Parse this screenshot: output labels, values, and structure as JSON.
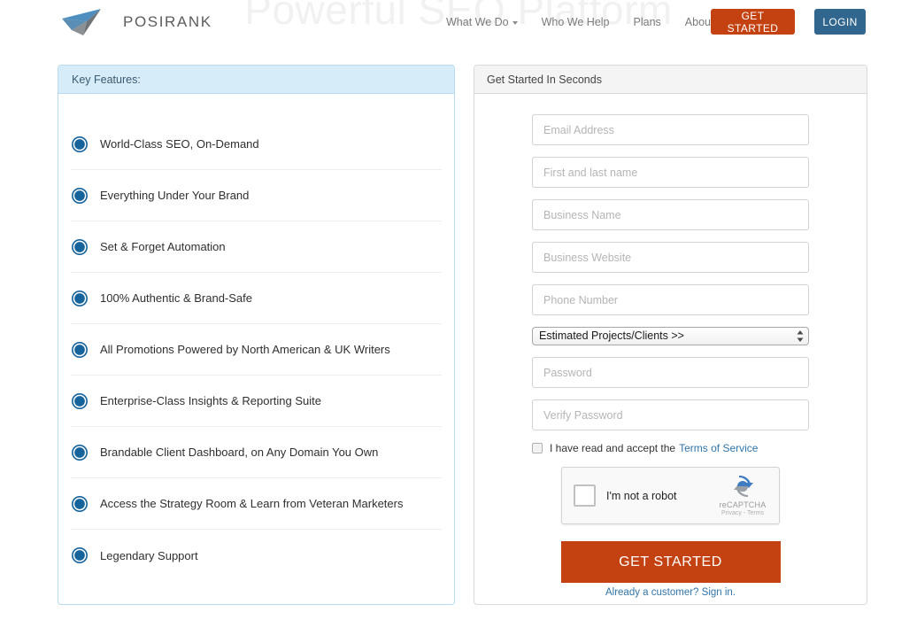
{
  "watermark": "Powerful SEO Platform",
  "header": {
    "brand_name": "POSIRANK",
    "logo_icon": "paper-plane-icon",
    "nav": [
      {
        "label": "What We Do",
        "has_caret": true
      },
      {
        "label": "Who We Help",
        "has_caret": false
      },
      {
        "label": "Plans",
        "has_caret": false
      },
      {
        "label": "About",
        "has_caret": false
      }
    ],
    "get_started_label": "GET STARTED",
    "login_label": "LOGIN",
    "colors": {
      "orange": "#c44211",
      "blue": "#31678e"
    }
  },
  "left_panel": {
    "title": "Key Features:",
    "header_bg": "#d7ecf9",
    "border": "#b8dcf0",
    "check_icon": "check-circle-icon",
    "features": [
      "World-Class SEO, On-Demand",
      "Everything Under Your Brand",
      "Set & Forget Automation",
      "100% Authentic & Brand-Safe",
      "All Promotions Powered by North American & UK Writers",
      "Enterprise-Class Insights & Reporting Suite",
      "Brandable Client Dashboard, on Any Domain You Own",
      "Access the Strategy Room & Learn from Veteran Marketers",
      "Legendary Support"
    ]
  },
  "right_panel": {
    "title": "Get Started In Seconds",
    "header_bg": "#f4f4f4",
    "border": "#dadada",
    "fields": [
      {
        "name": "email",
        "placeholder": "Email Address",
        "value": ""
      },
      {
        "name": "full-name",
        "placeholder": "First and last name",
        "value": ""
      },
      {
        "name": "business-name",
        "placeholder": "Business Name",
        "value": ""
      },
      {
        "name": "business-website",
        "placeholder": "Business Website",
        "value": ""
      },
      {
        "name": "phone-number",
        "placeholder": "Phone Number",
        "value": ""
      }
    ],
    "select": {
      "selected": "Estimated Projects/Clients >>",
      "options": [
        "Estimated Projects/Clients >>"
      ]
    },
    "password_fields": [
      {
        "name": "password",
        "placeholder": "Password",
        "value": ""
      },
      {
        "name": "verify-password",
        "placeholder": "Verify Password",
        "value": ""
      }
    ],
    "terms": {
      "checked": false,
      "text": "I have read and accept the",
      "link_label": "Terms of Service"
    },
    "recaptcha": {
      "checkbox_label": "I'm not a robot",
      "brand": "reCAPTCHA",
      "links": "Privacy - Terms",
      "checked": false
    },
    "submit_label": "GET STARTED",
    "signin_text": "Already a customer? Sign in."
  }
}
